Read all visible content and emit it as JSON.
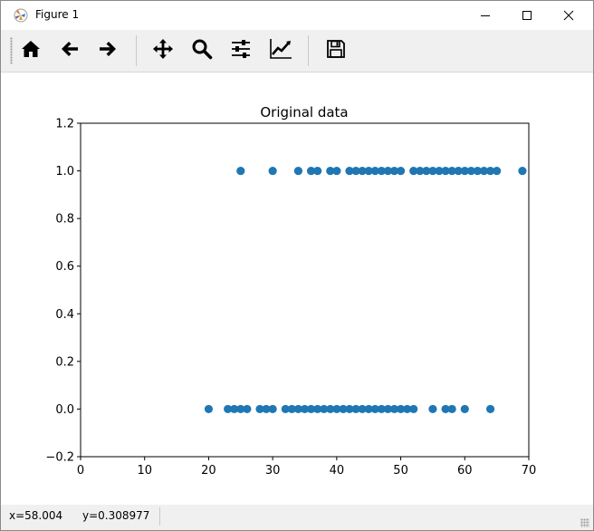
{
  "window": {
    "title": "Figure 1",
    "app_icon": "matplotlib-icon",
    "controls": [
      "minimize-icon",
      "maximize-icon",
      "close-icon"
    ]
  },
  "toolbar": {
    "buttons": [
      {
        "name": "home",
        "icon": "home-icon"
      },
      {
        "name": "back",
        "icon": "arrow-left-icon"
      },
      {
        "name": "forward",
        "icon": "arrow-right-icon"
      },
      {
        "name": "pan",
        "icon": "move-icon"
      },
      {
        "name": "zoom",
        "icon": "search-icon"
      },
      {
        "name": "subplots",
        "icon": "sliders-icon"
      },
      {
        "name": "edit",
        "icon": "line-chart-icon"
      },
      {
        "name": "save",
        "icon": "save-icon"
      }
    ]
  },
  "status": {
    "x": "x=58.004",
    "y": "y=0.308977"
  },
  "chart_data": {
    "type": "scatter",
    "title": "Original data",
    "xlabel": "",
    "ylabel": "",
    "xlim": [
      0,
      70
    ],
    "ylim": [
      -0.2,
      1.2
    ],
    "xticks": [
      "0",
      "10",
      "20",
      "30",
      "40",
      "50",
      "60",
      "70"
    ],
    "yticks": [
      "−0.2",
      "0.0",
      "0.2",
      "0.4",
      "0.6",
      "0.8",
      "1.0",
      "1.2"
    ],
    "grid": false,
    "marker_color": "#1f77b4",
    "series": [
      {
        "x": [
          25,
          30,
          34,
          36,
          37,
          39,
          40,
          42,
          43,
          44,
          45,
          46,
          47,
          48,
          49,
          50,
          52,
          53,
          54,
          55,
          56,
          57,
          58,
          59,
          60,
          61,
          62,
          63,
          64,
          65,
          69
        ],
        "y": [
          1,
          1,
          1,
          1,
          1,
          1,
          1,
          1,
          1,
          1,
          1,
          1,
          1,
          1,
          1,
          1,
          1,
          1,
          1,
          1,
          1,
          1,
          1,
          1,
          1,
          1,
          1,
          1,
          1,
          1,
          1
        ]
      },
      {
        "x": [
          20,
          23,
          24,
          25,
          26,
          28,
          29,
          30,
          32,
          33,
          34,
          35,
          36,
          37,
          38,
          39,
          40,
          41,
          42,
          43,
          44,
          45,
          46,
          47,
          48,
          49,
          50,
          51,
          52,
          55,
          57,
          58,
          60,
          64
        ],
        "y": [
          0,
          0,
          0,
          0,
          0,
          0,
          0,
          0,
          0,
          0,
          0,
          0,
          0,
          0,
          0,
          0,
          0,
          0,
          0,
          0,
          0,
          0,
          0,
          0,
          0,
          0,
          0,
          0,
          0,
          0,
          0,
          0,
          0,
          0
        ]
      }
    ]
  }
}
